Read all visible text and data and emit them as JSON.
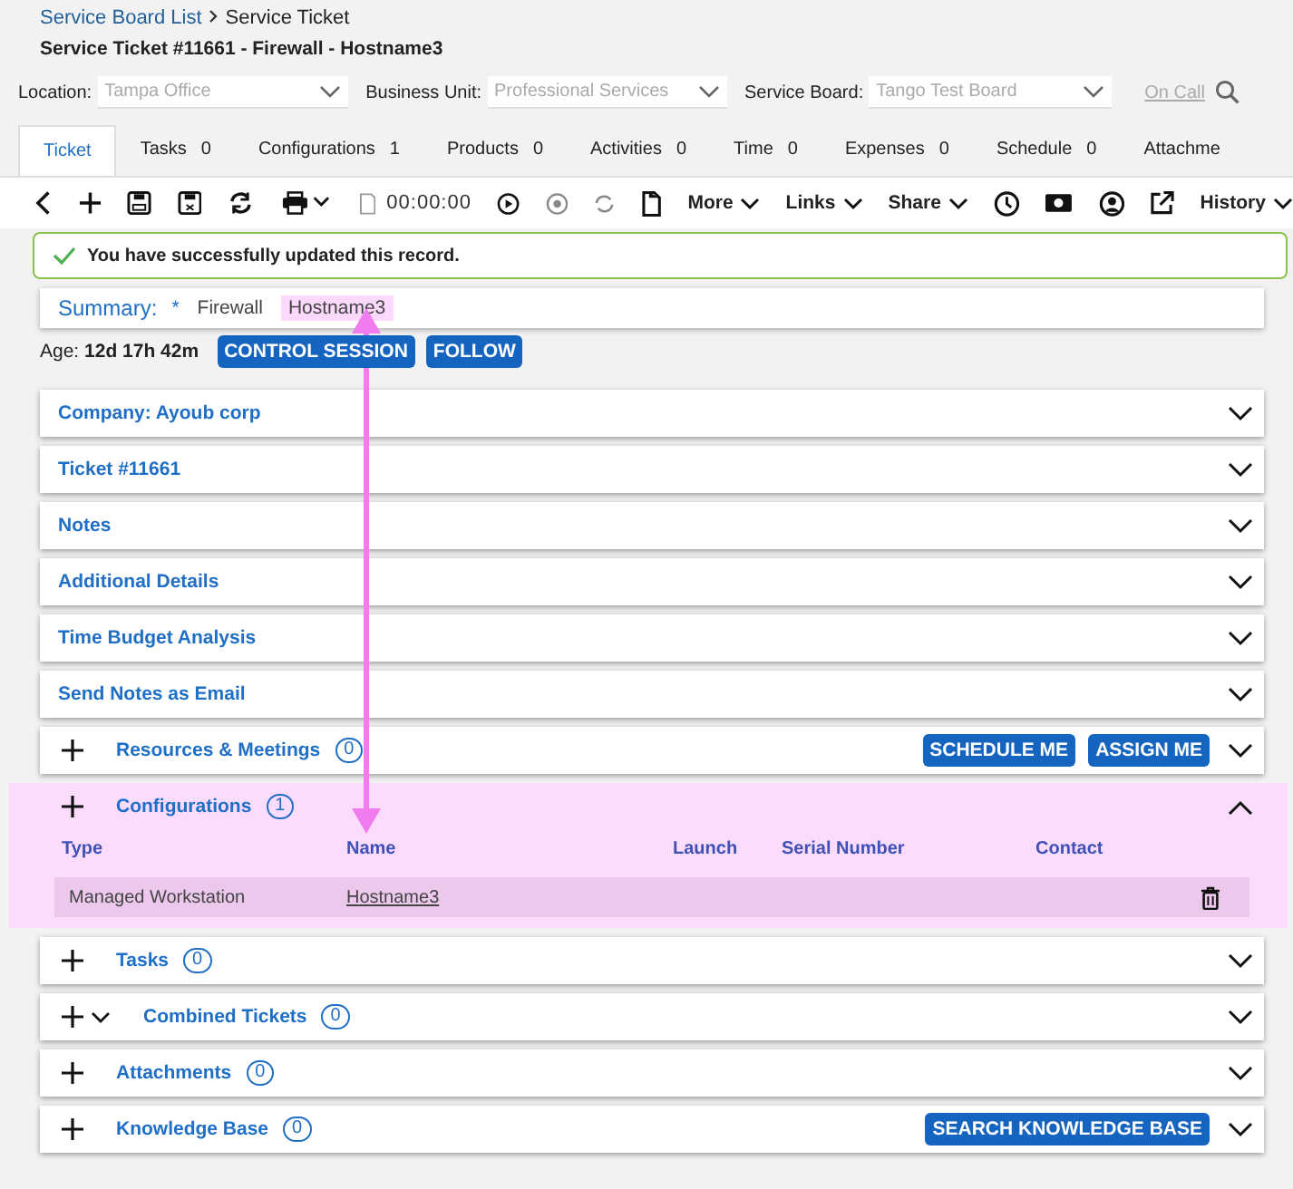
{
  "breadcrumb": {
    "link": "Service Board List",
    "current": "Service Ticket"
  },
  "title": "Service Ticket #11661 - Firewall - Hostname3",
  "filters": [
    {
      "label": "Location:",
      "value": "Tampa Office",
      "disabled": true
    },
    {
      "label": "Business Unit:",
      "value": "Professional Services",
      "disabled": true
    },
    {
      "label": "Service Board:",
      "value": "Tango Test Board",
      "disabled": true
    }
  ],
  "on_call": "On Call",
  "tabs": [
    {
      "label": "Ticket",
      "selected": true
    },
    {
      "label": "Tasks",
      "count": "0",
      "selected": false
    },
    {
      "label": "Configurations",
      "count": "1",
      "selected": false
    },
    {
      "label": "Products",
      "count": "0",
      "selected": false
    },
    {
      "label": "Activities",
      "count": "0",
      "selected": false
    },
    {
      "label": "Time",
      "count": "0",
      "selected": false
    },
    {
      "label": "Expenses",
      "count": "0",
      "selected": false
    },
    {
      "label": "Schedule",
      "count": "0",
      "selected": false
    },
    {
      "label": "Attachme",
      "selected": false
    }
  ],
  "toolbar": {
    "timer": "00:00:00",
    "menus": [
      "More",
      "Links",
      "Share",
      "History"
    ]
  },
  "message": "You have successfully updated this record.",
  "summary": {
    "label": "Summary:",
    "required_mark": "*",
    "parts": [
      {
        "text": "Firewall",
        "highlighted": false
      },
      {
        "text": "Hostname3",
        "highlighted": true
      }
    ]
  },
  "age": {
    "label": "Age:",
    "value": "12d 17h 42m"
  },
  "actions": [
    "CONTROL SESSION",
    "FOLLOW"
  ],
  "sections": [
    {
      "kind": "simple",
      "title": "Company: Ayoub corp",
      "expanded": false
    },
    {
      "kind": "simple",
      "title": "Ticket #11661",
      "expanded": false
    },
    {
      "kind": "simple",
      "title": "Notes",
      "expanded": false
    },
    {
      "kind": "simple",
      "title": "Additional Details",
      "expanded": false
    },
    {
      "kind": "simple",
      "title": "Time Budget Analysis",
      "expanded": false
    },
    {
      "kind": "simple",
      "title": "Send Notes as Email",
      "expanded": false
    },
    {
      "kind": "counted",
      "title": "Resources & Meetings",
      "count": "0",
      "expanded": false,
      "highlighted": false,
      "buttons": [
        "SCHEDULE ME",
        "ASSIGN ME"
      ]
    },
    {
      "kind": "counted",
      "title": "Configurations",
      "count": "1",
      "expanded": true,
      "highlighted": true,
      "columns": [
        "Type",
        "Name",
        "Launch",
        "Serial Number",
        "Contact"
      ],
      "rows": [
        {
          "type": "Managed Workstation",
          "name": "Hostname3"
        }
      ]
    },
    {
      "kind": "counted",
      "title": "Tasks",
      "count": "0",
      "expanded": false,
      "highlighted": false
    },
    {
      "kind": "combined",
      "title": "Combined Tickets",
      "count": "0",
      "expanded": false,
      "highlighted": false
    },
    {
      "kind": "counted",
      "title": "Attachments",
      "count": "0",
      "expanded": false,
      "highlighted": false
    },
    {
      "kind": "counted",
      "title": "Knowledge Base",
      "count": "0",
      "expanded": false,
      "highlighted": false,
      "buttons": [
        "SEARCH KNOWLEDGE BASE"
      ]
    }
  ]
}
